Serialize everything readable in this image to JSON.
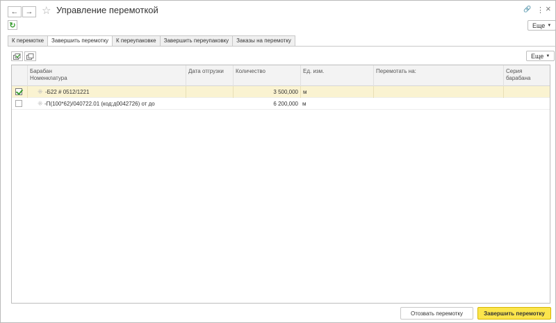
{
  "window": {
    "title": "Управление перемоткой",
    "back_icon": "←",
    "forward_icon": "→",
    "star_icon": "☆",
    "link_icon": "🔗",
    "menu_icon": "⋮",
    "close_icon": "×"
  },
  "commandbar": {
    "refresh_icon": "↻",
    "more_label": "Еще"
  },
  "tabs": [
    {
      "label": "К перемотке"
    },
    {
      "label": "Завершить перемотку"
    },
    {
      "label": "К переупаковке"
    },
    {
      "label": "Завершить переупаковку"
    },
    {
      "label": "Заказы на перемотку"
    }
  ],
  "active_tab": 1,
  "table_toolbar": {
    "more_label": "Еще"
  },
  "table": {
    "columns": {
      "drum": "Барабан",
      "nomenclature": "Номенклатура",
      "ship_date": "Дата отгрузки",
      "quantity": "Количество",
      "unit": "Ед. изм.",
      "rewind_to": "Перемотать на:",
      "drum_series": "Серия барабана"
    },
    "rows": [
      {
        "checked": true,
        "name": "-Б22 # 0512/1221",
        "ship_date": "",
        "quantity": "3 500,000",
        "unit": "м",
        "rewind_to": "",
        "drum_series": ""
      },
      {
        "checked": false,
        "name": "-П(100*62)/040722.01 (код:д0042726) от  до",
        "ship_date": "",
        "quantity": "6 200,000",
        "unit": "м",
        "rewind_to": "",
        "drum_series": ""
      }
    ]
  },
  "buttons": {
    "recall": "Отозвать перемотку",
    "finish": "Завершить перемотку"
  }
}
